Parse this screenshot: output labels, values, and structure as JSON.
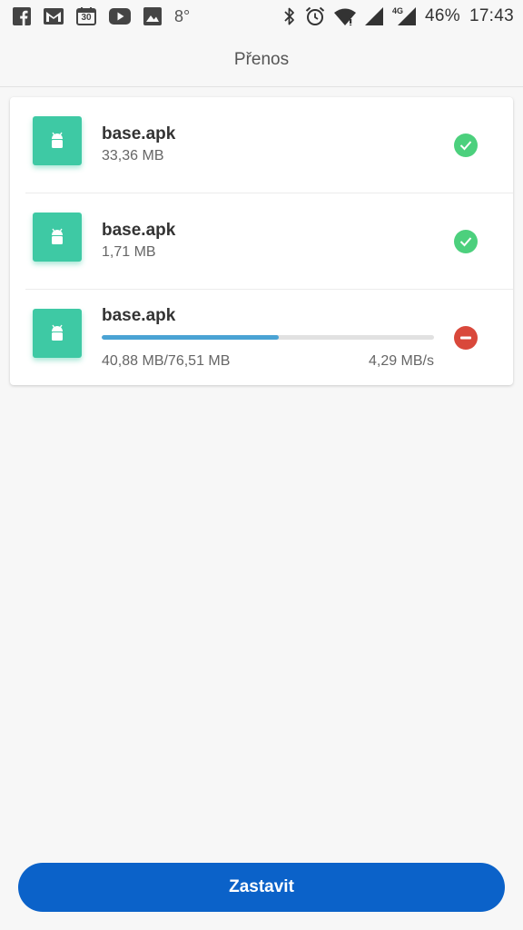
{
  "status_bar": {
    "icons_left": [
      "facebook-icon",
      "gmail-icon",
      "calendar-icon",
      "youtube-icon",
      "gallery-icon"
    ],
    "calendar_day": "30",
    "temperature": "8°",
    "network_type": "4G",
    "battery": "46%",
    "time": "17:43",
    "icons_right": [
      "bluetooth-icon",
      "alarm-icon",
      "wifi-icon",
      "cell-signal-icon",
      "cell-signal-4g-icon"
    ]
  },
  "header": {
    "title": "Přenos"
  },
  "transfers": [
    {
      "name": "base.apk",
      "size": "33,36 MB",
      "status": "done"
    },
    {
      "name": "base.apk",
      "size": "1,71 MB",
      "status": "done"
    },
    {
      "name": "base.apk",
      "progress_text": "40,88 MB/76,51 MB",
      "speed": "4,29 MB/s",
      "progress": 0.534,
      "status": "in-progress"
    }
  ],
  "footer": {
    "stop_label": "Zastavit"
  },
  "colors": {
    "app_icon": "#3ec9a4",
    "done": "#4cd07d",
    "cancel": "#d9483b",
    "progress": "#4aa3d4",
    "primary_button": "#0b62c9"
  }
}
